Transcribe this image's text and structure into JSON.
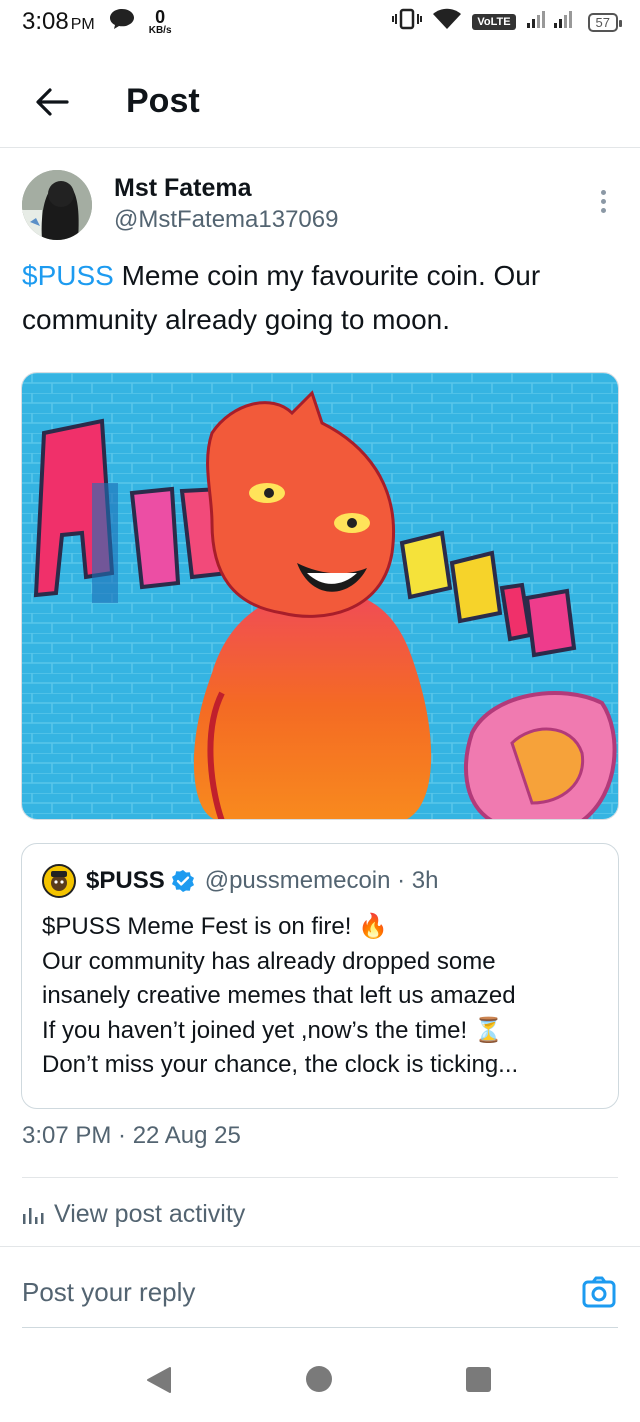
{
  "status_bar": {
    "time": "3:08",
    "ampm": "PM",
    "speed_value": "0",
    "speed_unit": "KB/s",
    "volte": "VoLTE",
    "battery": "57"
  },
  "header": {
    "title": "Post"
  },
  "post": {
    "author_name": "Mst Fatema",
    "author_handle": "@MstFatema137069",
    "cashtag": "$PUSS",
    "text_rest": " Meme coin my favourite coin. Our community already going to moon.",
    "timestamp": "3:07 PM · 22 Aug 25"
  },
  "quote": {
    "name": "$PUSS",
    "handle": "@pussmemecoin · 3h",
    "lines": [
      "$PUSS Meme Fest is on fire! 🔥",
      "Our community has already dropped some",
      "insanely creative memes that left us amazed",
      "If you haven’t joined yet ,now’s the time! ⏳",
      "Don’t miss your chance, the clock is ticking..."
    ]
  },
  "activity": {
    "label": "View post activity"
  },
  "reply": {
    "placeholder": "Post your reply"
  },
  "colors": {
    "accent": "#1d9bf0",
    "text": "#0f1419",
    "secondary": "#536471"
  }
}
